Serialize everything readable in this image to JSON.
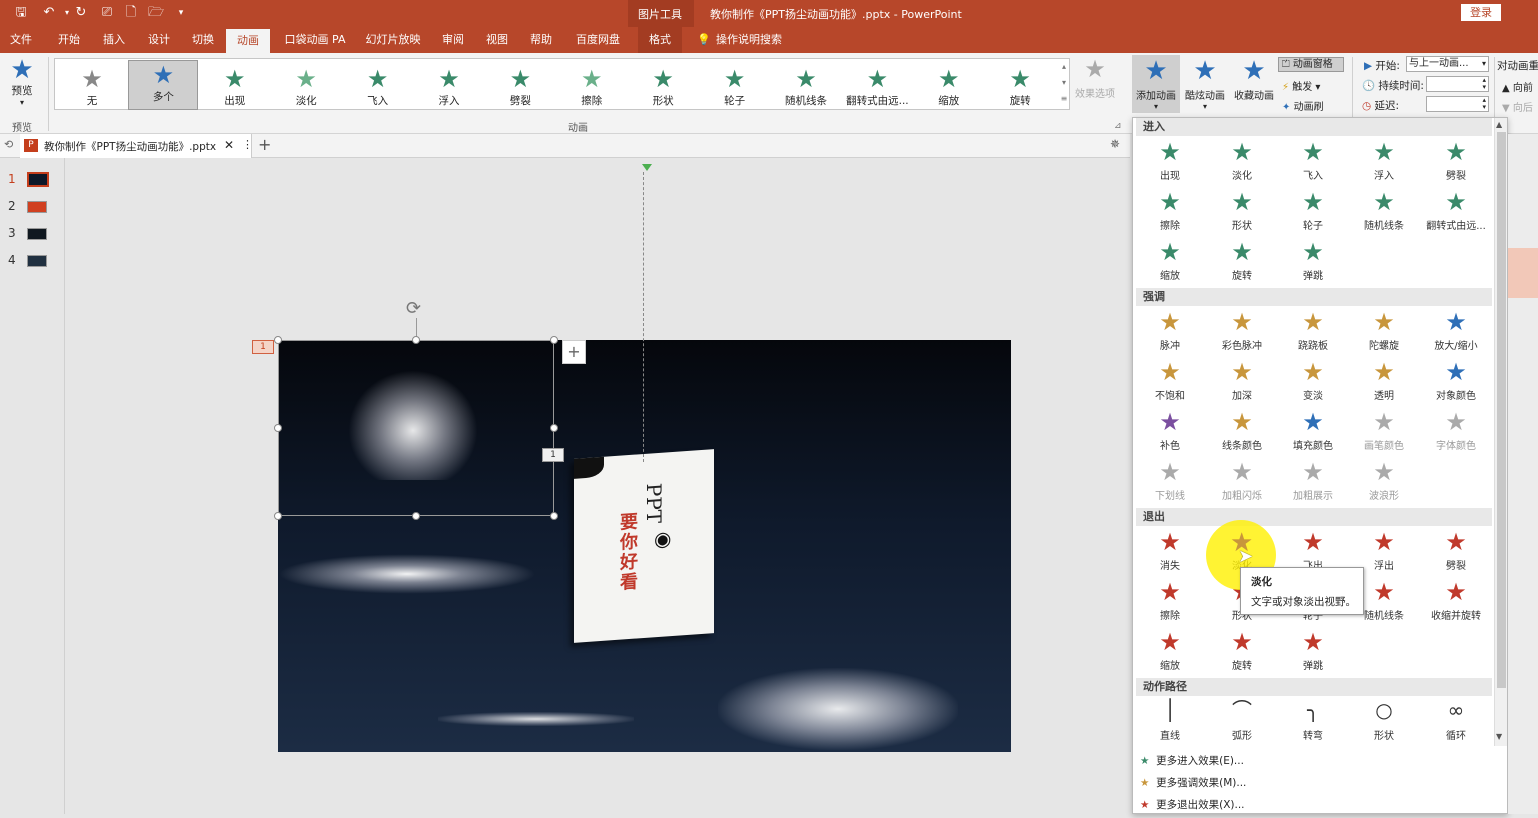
{
  "titlebar": {
    "context_tab": "图片工具",
    "title": "教你制作《PPT扬尘动画功能》.pptx - PowerPoint",
    "login": "登录"
  },
  "tabs": [
    "文件",
    "开始",
    "插入",
    "设计",
    "切换",
    "动画",
    "口袋动画 PA",
    "幻灯片放映",
    "审阅",
    "视图",
    "帮助",
    "百度网盘",
    "格式"
  ],
  "tell_me": "操作说明搜索",
  "ribbon": {
    "preview_label": "预览",
    "preview_group": "预览",
    "animation_group": "动画",
    "gallery": [
      "无",
      "多个",
      "出现",
      "淡化",
      "飞入",
      "浮入",
      "劈裂",
      "擦除",
      "形状",
      "轮子",
      "随机线条",
      "翻转式由远...",
      "缩放",
      "旋转"
    ],
    "effect_options": "效果选项",
    "add_animation": "添加动画",
    "cool_animation": "酷炫动画",
    "fav_animation": "收藏动画",
    "anim_pane": "动画窗格",
    "trigger": "触发",
    "anim_brush": "动画刷",
    "start_label": "开始:",
    "start_value": "与上一动画...",
    "duration_label": "持续时间:",
    "delay_label": "延迟:",
    "reorder": "对动画重",
    "forward": "向前",
    "backward": "向后"
  },
  "doc_tab": "教你制作《PPT扬尘动画功能》.pptx",
  "slides": [
    "1",
    "2",
    "3",
    "4"
  ],
  "colors": {
    "accent": "#b7472a",
    "entrance": "#3a8a6a",
    "emphasis": "#c8963c",
    "exit": "#c0392b"
  },
  "panel": {
    "sections": {
      "entrance": "进入",
      "emphasis": "强调",
      "exit": "退出",
      "path": "动作路径"
    },
    "entrance": [
      "出现",
      "淡化",
      "飞入",
      "浮入",
      "劈裂",
      "擦除",
      "形状",
      "轮子",
      "随机线条",
      "翻转式由远...",
      "缩放",
      "旋转",
      "弹跳"
    ],
    "emphasis": [
      "脉冲",
      "彩色脉冲",
      "跷跷板",
      "陀螺旋",
      "放大/缩小",
      "不饱和",
      "加深",
      "变淡",
      "透明",
      "对象颜色",
      "补色",
      "线条颜色",
      "填充颜色",
      "画笔颜色",
      "字体颜色",
      "下划线",
      "加粗闪烁",
      "加粗展示",
      "波浪形"
    ],
    "exit": [
      "消失",
      "淡化",
      "飞出",
      "浮出",
      "劈裂",
      "擦除",
      "形状",
      "轮子",
      "随机线条",
      "收缩并旋转",
      "缩放",
      "旋转",
      "弹跳"
    ],
    "path": [
      "直线",
      "弧形",
      "转弯",
      "形状",
      "循环"
    ],
    "more": [
      "更多进入效果(E)...",
      "更多强调效果(M)...",
      "更多退出效果(X)..."
    ]
  },
  "tooltip": {
    "title": "淡化",
    "desc": "文字或对象淡出视野。"
  },
  "slide": {
    "anim_tag": "1",
    "anim_tag2": "1",
    "book_title": "PPT",
    "book_subtitle": "要你好看"
  }
}
